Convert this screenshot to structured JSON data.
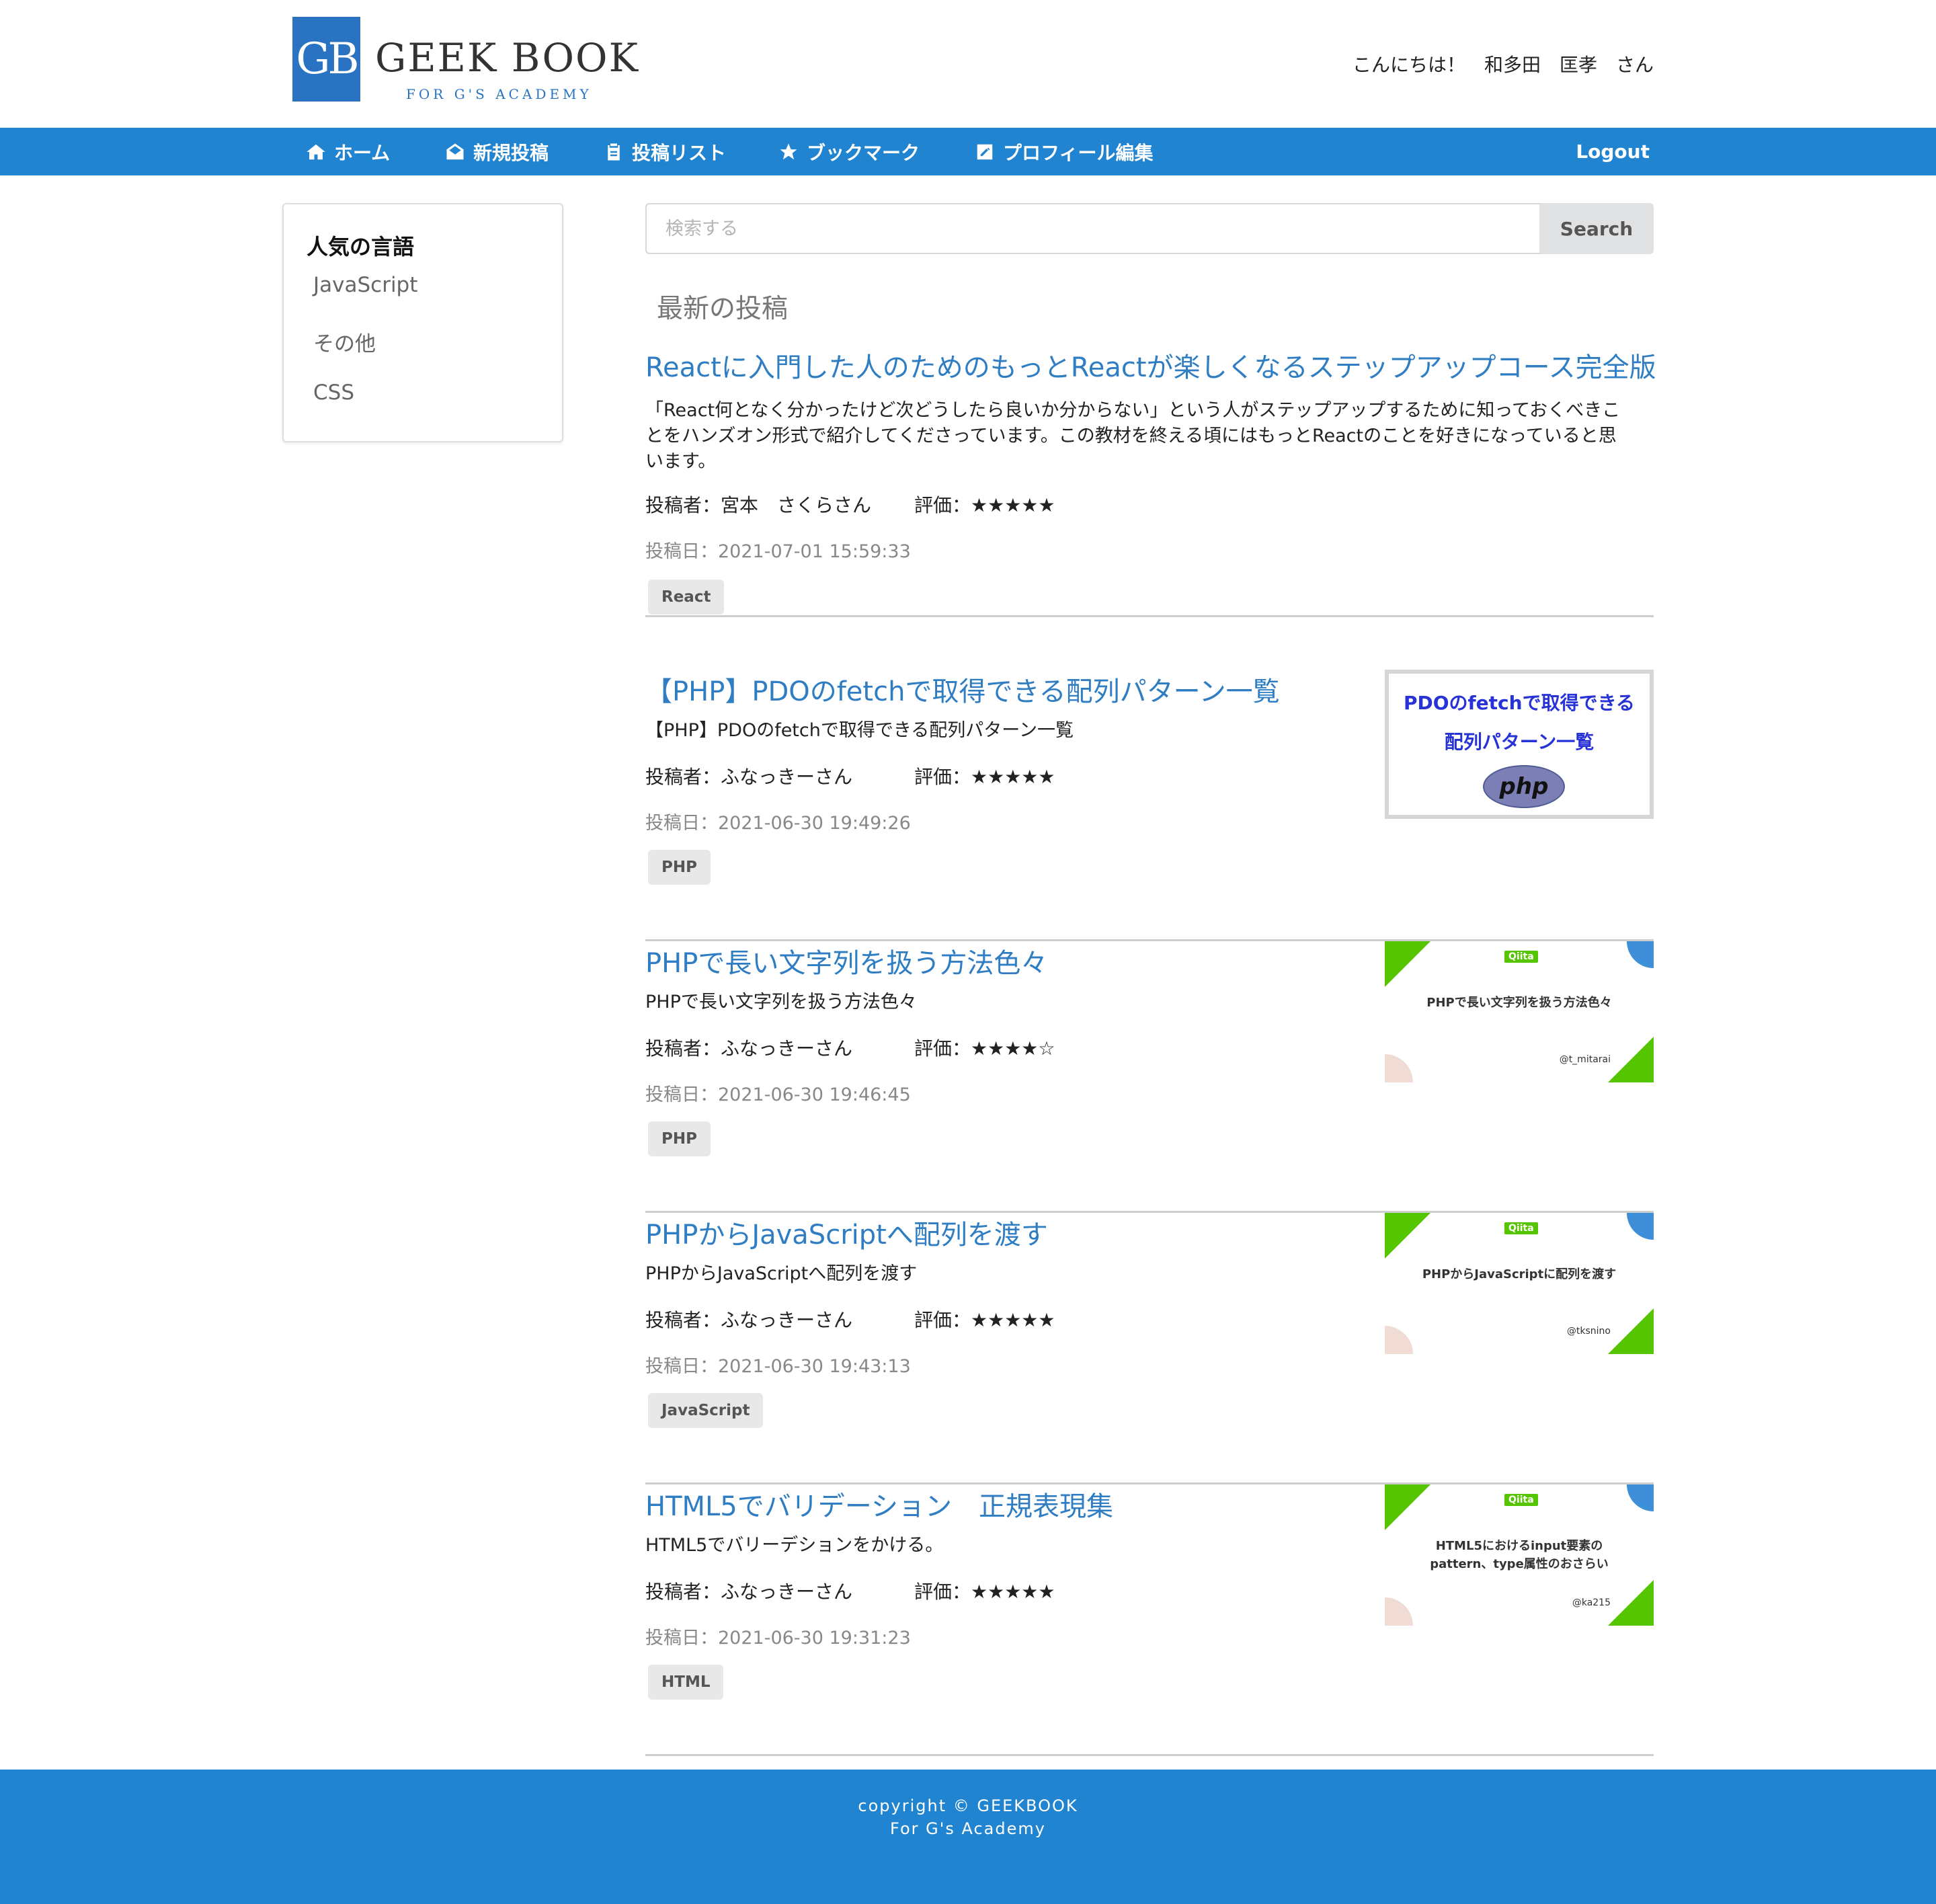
{
  "brand": {
    "logo_mark": "GB",
    "name": "GEEK BOOK",
    "subtitle": "FOR G'S ACADEMY",
    "color": "#2a73c2"
  },
  "header": {
    "greeting": "こんにちは！　和多田　匡孝　さん"
  },
  "nav": {
    "background": "#2184d0",
    "items": [
      {
        "label": "ホーム",
        "icon": "home-icon"
      },
      {
        "label": "新規投稿",
        "icon": "envelope-open-icon"
      },
      {
        "label": "投稿リスト",
        "icon": "clipboard-list-icon"
      },
      {
        "label": "ブックマーク",
        "icon": "star-icon"
      },
      {
        "label": "プロフィール編集",
        "icon": "edit-icon"
      }
    ],
    "logout": "Logout"
  },
  "sidebar": {
    "title": "人気の言語",
    "items": [
      {
        "label": "JavaScript"
      },
      {
        "label": "その他"
      },
      {
        "label": "CSS"
      }
    ]
  },
  "search": {
    "placeholder": "検索する",
    "button": "Search"
  },
  "main": {
    "section_title": "最新の投稿",
    "posts": [
      {
        "title": "Reactに入門した人のためのもっとReactが楽しくなるステップアップコース完全版",
        "description": "「React何となく分かったけど次どうしたら良いか分からない」という人がステップアップするために知っておくべきことをハンズオン形式で紹介してくださっています。この教材を終える頃にはもっとReactのことを好きになっていると思います。",
        "author": "投稿者：宮本　さくらさん",
        "rating": "評価：★★★★★",
        "date": "投稿日：2021-07-01 15:59:33",
        "tag": "React"
      },
      {
        "title": "【PHP】PDOのfetchで取得できる配列パターン一覧",
        "description": "【PHP】PDOのfetchで取得できる配列パターン一覧",
        "author": "投稿者：ふなっきーさん",
        "rating": "評価：★★★★★",
        "date": "投稿日：2021-06-30 19:49:26",
        "tag": "PHP",
        "thumbnail": {
          "line1": "PDOのfetchで取得できる",
          "line2": "配列パターン一覧",
          "logo": "php"
        }
      },
      {
        "title": "PHPで長い文字列を扱う方法色々",
        "description": "PHPで長い文字列を扱う方法色々",
        "author": "投稿者：ふなっきーさん",
        "rating": "評価：★★★★☆",
        "date": "投稿日：2021-06-30 19:46:45",
        "tag": "PHP",
        "thumbnail": {
          "badge": "Qiita",
          "text": "PHPで長い文字列を扱う方法色々",
          "user": "@t_mitarai"
        }
      },
      {
        "title": "PHPからJavaScriptへ配列を渡す",
        "description": "PHPからJavaScriptへ配列を渡す",
        "author": "投稿者：ふなっきーさん",
        "rating": "評価：★★★★★",
        "date": "投稿日：2021-06-30 19:43:13",
        "tag": "JavaScript",
        "thumbnail": {
          "badge": "Qiita",
          "text": "PHPからJavaScriptに配列を渡す",
          "user": "@tksnino"
        }
      },
      {
        "title": "HTML5でバリデーション　正規表現集",
        "description": "HTML5でバリーデションをかける。",
        "author": "投稿者：ふなっきーさん",
        "rating": "評価：★★★★★",
        "date": "投稿日：2021-06-30 19:31:23",
        "tag": "HTML",
        "thumbnail": {
          "badge": "Qiita",
          "text": "HTML5におけるinput要素のpattern、type属性のおさらい",
          "user": "@ka215"
        }
      }
    ]
  },
  "footer": {
    "line1": "copyright © GEEKBOOK",
    "line2": "For G's Academy"
  }
}
